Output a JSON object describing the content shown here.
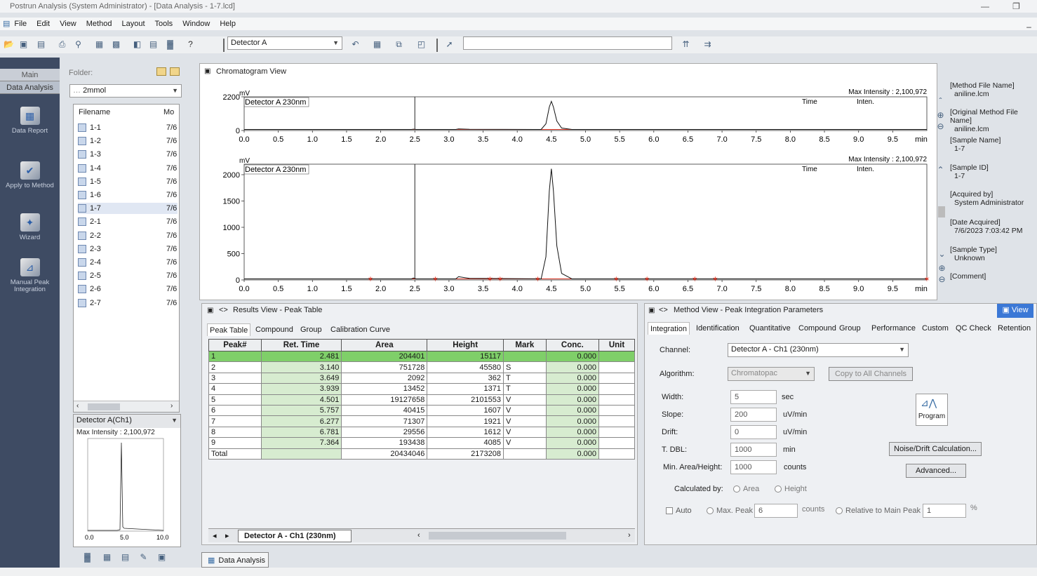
{
  "window": {
    "title": "Postrun Analysis (System Administrator) - [Data Analysis - 1-7.lcd]"
  },
  "menu": [
    "File",
    "Edit",
    "View",
    "Method",
    "Layout",
    "Tools",
    "Window",
    "Help"
  ],
  "toolbar": {
    "detector": "Detector A",
    "help": "?"
  },
  "nav": {
    "tabs": [
      "Main",
      "Data Analysis"
    ],
    "items": [
      "Data Report",
      "Apply to Method",
      "Wizard",
      "Manual Peak Integration"
    ]
  },
  "folder": {
    "label": "Folder:",
    "path": "2mmol",
    "col_filename": "Filename",
    "col_mod": "Mo",
    "files": [
      {
        "name": "1-1",
        "date": "7/6"
      },
      {
        "name": "1-2",
        "date": "7/6"
      },
      {
        "name": "1-3",
        "date": "7/6"
      },
      {
        "name": "1-4",
        "date": "7/6"
      },
      {
        "name": "1-5",
        "date": "7/6"
      },
      {
        "name": "1-6",
        "date": "7/6"
      },
      {
        "name": "1-7",
        "date": "7/6"
      },
      {
        "name": "2-1",
        "date": "7/6"
      },
      {
        "name": "2-2",
        "date": "7/6"
      },
      {
        "name": "2-3",
        "date": "7/6"
      },
      {
        "name": "2-4",
        "date": "7/6"
      },
      {
        "name": "2-5",
        "date": "7/6"
      },
      {
        "name": "2-6",
        "date": "7/6"
      },
      {
        "name": "2-7",
        "date": "7/6"
      }
    ],
    "channel": "Detector A(Ch1)",
    "thumb_max": "Max Intensity : 2,100,972",
    "thumb_ticks": [
      "0.0",
      "5.0",
      "10.0"
    ]
  },
  "chromatogram": {
    "title": "Chromatogram View",
    "max_top": "Max Intensity : 2,100,972",
    "max_bottom": "Max Intensity : 2,100,972",
    "legend": "Detector A 230nm",
    "unit": "mV",
    "xunit": "min",
    "col_time": "Time",
    "col_inten": "Inten.",
    "top_yticks": [
      "2200",
      "0"
    ],
    "bottom_yticks": [
      "2000",
      "1500",
      "1000",
      "500",
      "0"
    ],
    "xticks": [
      "0.0",
      "0.5",
      "1.0",
      "1.5",
      "2.0",
      "2.5",
      "3.0",
      "3.5",
      "4.0",
      "4.5",
      "5.0",
      "5.5",
      "6.0",
      "6.5",
      "7.0",
      "7.5",
      "8.0",
      "8.5",
      "9.0",
      "9.5"
    ],
    "markers": [
      1.85,
      2.8,
      3.6,
      3.75,
      4.3,
      5.45,
      5.9,
      6.6,
      6.9,
      10.0
    ]
  },
  "info": [
    {
      "k": "[Method File Name]",
      "v": "aniline.lcm"
    },
    {
      "k": "[Original Method File Name]",
      "v": "aniline.lcm"
    },
    {
      "k": "[Sample Name]",
      "v": "1-7"
    },
    {
      "k": "[Sample ID]",
      "v": "1-7"
    },
    {
      "k": "[Acquired by]",
      "v": "System Administrator"
    },
    {
      "k": "[Date Acquired]",
      "v": "7/6/2023 7:03:42 PM"
    },
    {
      "k": "[Sample Type]",
      "v": "Unknown"
    },
    {
      "k": "[Comment]",
      "v": ""
    }
  ],
  "results": {
    "title": "Results View - Peak Table",
    "tabs": [
      "Peak Table",
      "Compound",
      "Group",
      "Calibration Curve"
    ],
    "headers": [
      "Peak#",
      "Ret. Time",
      "Area",
      "Height",
      "Mark",
      "Conc.",
      "Unit"
    ],
    "rows": [
      [
        "1",
        "2.481",
        "204401",
        "15117",
        "",
        "0.000",
        ""
      ],
      [
        "2",
        "3.140",
        "751728",
        "45580",
        "S",
        "0.000",
        ""
      ],
      [
        "3",
        "3.649",
        "2092",
        "362",
        "T",
        "0.000",
        ""
      ],
      [
        "4",
        "3.939",
        "13452",
        "1371",
        "T",
        "0.000",
        ""
      ],
      [
        "5",
        "4.501",
        "19127658",
        "2101553",
        "V",
        "0.000",
        ""
      ],
      [
        "6",
        "5.757",
        "40415",
        "1607",
        "V",
        "0.000",
        ""
      ],
      [
        "7",
        "6.277",
        "71307",
        "1921",
        "V",
        "0.000",
        ""
      ],
      [
        "8",
        "6.781",
        "29556",
        "1612",
        "V",
        "0.000",
        ""
      ],
      [
        "9",
        "7.364",
        "193438",
        "4085",
        "V",
        "0.000",
        ""
      ],
      [
        "Total",
        "",
        "20434046",
        "2173208",
        "",
        "0.000",
        ""
      ]
    ],
    "sheet_tab": "Detector A - Ch1 (230nm)"
  },
  "method": {
    "title": "Method View - Peak Integration Parameters",
    "view_btn": "View",
    "tabs": [
      "Integration",
      "Identification",
      "Quantitative",
      "Compound",
      "Group",
      "Performance",
      "Custom",
      "QC Check",
      "Retention"
    ],
    "channel_label": "Channel:",
    "channel": "Detector A - Ch1 (230nm)",
    "algorithm_label": "Algorithm:",
    "algorithm": "Chromatopac",
    "copy_btn": "Copy to All Channels",
    "width_label": "Width:",
    "width": "5",
    "width_unit": "sec",
    "slope_label": "Slope:",
    "slope": "200",
    "slope_unit": "uV/min",
    "drift_label": "Drift:",
    "drift": "0",
    "drift_unit": "uV/min",
    "tdbl_label": "T. DBL:",
    "tdbl": "1000",
    "tdbl_unit": "min",
    "minarea_label": "Min. Area/Height:",
    "minarea": "1000",
    "minarea_unit": "counts",
    "calc_label": "Calculated by:",
    "area": "Area",
    "height": "Height",
    "auto": "Auto",
    "maxpeak": "Max. Peak",
    "maxpeak_val": "6",
    "counts": "counts",
    "relmain": "Relative to Main Peak",
    "rel_val": "1",
    "pct": "%",
    "program": "Program",
    "noise_btn": "Noise/Drift Calculation...",
    "advanced_btn": "Advanced..."
  },
  "bottom_tab": "Data Analysis"
}
